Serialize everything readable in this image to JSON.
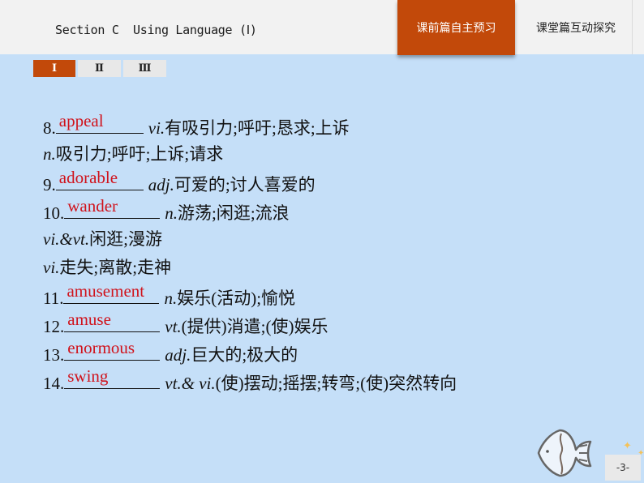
{
  "header": {
    "title": "Section C  Using Language (Ⅰ)",
    "tabs": [
      {
        "label": "课前篇自主预习",
        "active": true
      },
      {
        "label": "课堂篇互动探究",
        "active": false
      }
    ]
  },
  "subtabs": [
    {
      "label": "Ⅰ",
      "active": true
    },
    {
      "label": "Ⅱ",
      "active": false
    },
    {
      "label": "Ⅲ",
      "active": false
    }
  ],
  "colors": {
    "accent": "#c2490a",
    "background": "#c5dff8",
    "answer": "#d0121b"
  },
  "entries": [
    {
      "number": "8.",
      "answer": "appeal",
      "pos": "vi.",
      "meaning": "有吸引力;呼吁;恳求;上诉"
    },
    {
      "pos": "n.",
      "meaning": "吸引力;呼吁;上诉;请求"
    },
    {
      "number": "9.",
      "answer": "adorable",
      "pos": "adj.",
      "meaning": "可爱的;讨人喜爱的"
    },
    {
      "number": "10.",
      "answer": "wander",
      "pos": "n.",
      "meaning": "游荡;闲逛;流浪"
    },
    {
      "pos": "vi.&vt.",
      "meaning": "闲逛;漫游"
    },
    {
      "pos": "vi.",
      "meaning": "走失;离散;走神"
    },
    {
      "number": "11.",
      "answer": "amusement",
      "pos": "n.",
      "meaning": "娱乐(活动);愉悦"
    },
    {
      "number": "12.",
      "answer": "amuse",
      "pos": "vt.",
      "meaning": "(提供)消遣;(使)娱乐"
    },
    {
      "number": "13.",
      "answer": "enormous",
      "pos": "adj.",
      "meaning": "巨大的;极大的"
    },
    {
      "number": "14.",
      "answer": "swing",
      "pos": "vt.& vi.",
      "meaning": "(使)摆动;摇摆;转弯;(使)突然转向"
    }
  ],
  "page_number": "-3-"
}
